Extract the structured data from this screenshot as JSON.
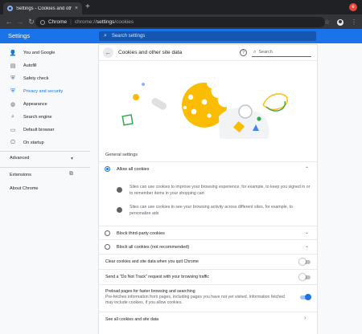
{
  "browser": {
    "tab_title": "Settings - Cookies and oth",
    "tab_close": "×",
    "newtab": "+",
    "profile_badge": "e",
    "url_host": "Chrome",
    "url_sep": "|",
    "url_prefix": "chrome://",
    "url_page": "settings",
    "url_suffix": "/cookies",
    "back": "←",
    "forward": "→",
    "reload": "↻",
    "star": "☆",
    "menu": "⋮"
  },
  "header": {
    "title": "Settings",
    "search_placeholder": "Search settings",
    "search_icon": "⌕"
  },
  "sidebar": {
    "items": [
      {
        "label": "You and Google",
        "icon": "person-icon",
        "glyph": "👤"
      },
      {
        "label": "Autofill",
        "icon": "clipboard-icon",
        "glyph": "▤"
      },
      {
        "label": "Safety check",
        "icon": "shield-icon",
        "glyph": "⛨"
      },
      {
        "label": "Privacy and security",
        "icon": "shield-lock-icon",
        "glyph": "⛨"
      },
      {
        "label": "Appearance",
        "icon": "palette-icon",
        "glyph": "◍"
      },
      {
        "label": "Search engine",
        "icon": "search-icon",
        "glyph": "⌕"
      },
      {
        "label": "Default browser",
        "icon": "browser-icon",
        "glyph": "▭"
      },
      {
        "label": "On startup",
        "icon": "power-icon",
        "glyph": "⏻"
      }
    ],
    "advanced": "Advanced",
    "advanced_chev": "▾",
    "extensions": "Extensions",
    "extensions_icon": "⧉",
    "about": "About Chrome"
  },
  "card": {
    "back_icon": "←",
    "title": "Cookies and other site data",
    "help_icon": "?",
    "search_icon": "⌕",
    "search_placeholder": "Search",
    "section_label": "General settings",
    "allow_all": "Allow all cookies",
    "allow_chev": "⌃",
    "allow_sub1": "Sites can use cookies to improve your browsing experience, for example, to keep you signed in or to remember items in your shopping cart",
    "allow_sub2": "Sites can use cookies to see your browsing activity across different sites, for example, to personalize ads",
    "block_third": "Block third-party cookies",
    "block_all": "Block all cookies (not recommended)",
    "row_chev": "⌄",
    "clear_on_exit": "Clear cookies and site data when you quit Chrome",
    "dnt": "Send a \"Do Not Track\" request with your browsing traffic",
    "preload_title": "Preload pages for faster browsing and searching",
    "preload_desc": "Pre-fetches information from pages, including pages you have not yet visited. Information fetched may include cookies, if you allow cookies.",
    "see_all": "See all cookies and site data",
    "arrow": "›"
  },
  "state": {
    "selected_radio": "allow_all",
    "clear_on_exit": false,
    "dnt": false,
    "preload": true
  }
}
